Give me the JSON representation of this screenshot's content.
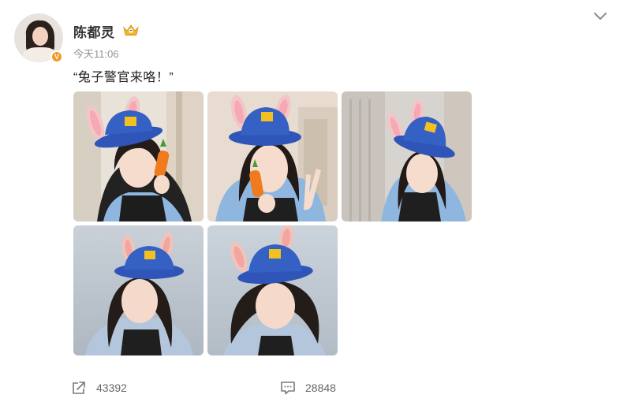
{
  "post": {
    "author": "陈都灵",
    "verified_badge": "V",
    "time": "今天11:06",
    "text": "“兔子警官来咯！”",
    "images": [
      {
        "icon": "bunny-police-photo-carrot"
      },
      {
        "icon": "bunny-police-photo-peace-sign"
      },
      {
        "icon": "bunny-police-photo-leaning"
      },
      {
        "icon": "bunny-police-photo-portrait"
      },
      {
        "icon": "bunny-police-photo-smile"
      }
    ]
  },
  "footer": {
    "share_count": "43392",
    "comment_count": "28848"
  },
  "colors": {
    "hat_blue": "#2f55b8",
    "badge_yellow": "#f2c11f",
    "verified_orange": "#f39a1f",
    "muted_text": "#939393"
  }
}
